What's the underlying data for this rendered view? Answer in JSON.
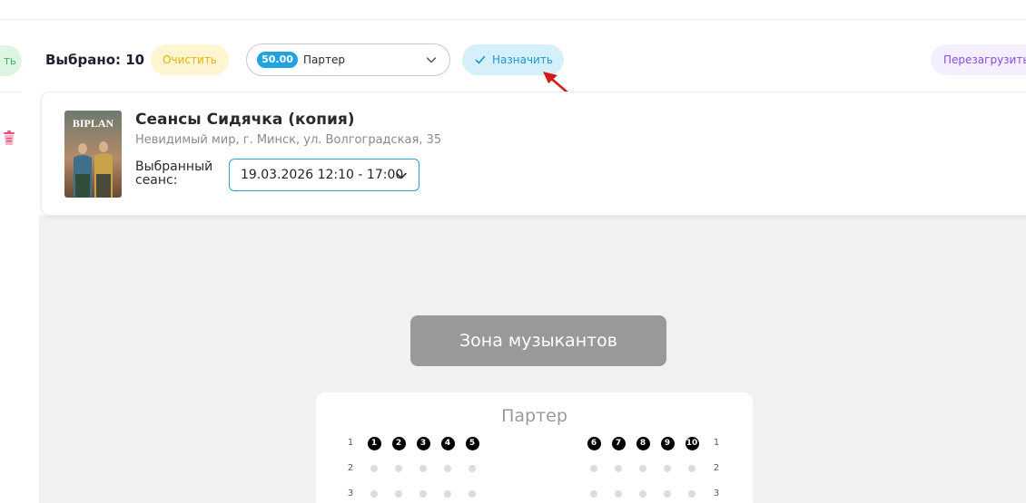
{
  "toolbar": {
    "selected_label": "Выбрано: 10",
    "clear_label": "Очистить",
    "zone_price": "50.00",
    "zone_name": "Партер",
    "assign_label": "Назначить",
    "reload_label": "Перезагрузить"
  },
  "sidebar": {
    "partial_button_label": "ть"
  },
  "event": {
    "poster_text": "BIPLAN",
    "title": "Сеансы Сидячка (копия)",
    "address": "Невидимый мир, г. Минск, ул. Волгоградская, 35",
    "session_label": "Выбранный сеанс:",
    "session_value": "19.03.2026 12:10 - 17:00"
  },
  "hall": {
    "stage_label": "Зона музыкантов",
    "section_title": "Партер",
    "rows": [
      "1",
      "2",
      "3"
    ],
    "selected_seats_left": [
      "1",
      "2",
      "3",
      "4",
      "5"
    ],
    "selected_seats_right": [
      "6",
      "7",
      "8",
      "9",
      "10"
    ]
  },
  "colors": {
    "accent": "#20a3df",
    "clear_bg": "#fff5d1",
    "clear_text": "#e7b100",
    "assign_bg": "#d5f0fb",
    "reload_text": "#8b4ddb",
    "arrow": "#d11a1a",
    "stage_bg": "#999999"
  }
}
